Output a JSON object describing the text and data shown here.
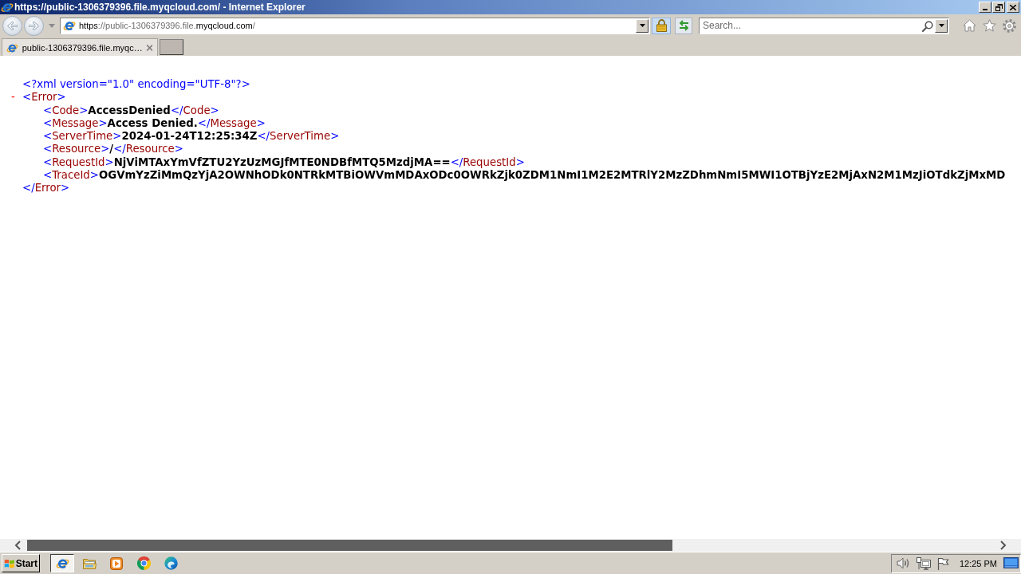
{
  "window": {
    "title": "https://public-1306379396.file.myqcloud.com/ - Internet Explorer"
  },
  "address_bar": {
    "url": [
      {
        "text": "https",
        "emphasis": true
      },
      {
        "text": "://public-1306379396.file.",
        "emphasis": false
      },
      {
        "text": "myqcloud.com",
        "emphasis": true
      },
      {
        "text": "/",
        "emphasis": false
      }
    ]
  },
  "search": {
    "placeholder": "Search..."
  },
  "tabs": [
    {
      "label": "public-1306379396.file.myqc…",
      "selected": true
    }
  ],
  "document": {
    "declaration": "<?xml version=\"1.0\" encoding=\"UTF-8\"?>",
    "root": {
      "toggle": "-",
      "open": [
        {
          "kind": "mark",
          "text": "<"
        },
        {
          "kind": "tag",
          "text": "Error"
        },
        {
          "kind": "mark",
          "text": ">"
        }
      ],
      "children": [
        {
          "tokens": [
            {
              "kind": "mark",
              "text": "<"
            },
            {
              "kind": "tag",
              "text": "Code"
            },
            {
              "kind": "mark",
              "text": ">"
            },
            {
              "kind": "value",
              "text": "AccessDenied"
            },
            {
              "kind": "mark",
              "text": "</"
            },
            {
              "kind": "tag",
              "text": "Code"
            },
            {
              "kind": "mark",
              "text": ">"
            }
          ]
        },
        {
          "tokens": [
            {
              "kind": "mark",
              "text": "<"
            },
            {
              "kind": "tag",
              "text": "Message"
            },
            {
              "kind": "mark",
              "text": ">"
            },
            {
              "kind": "value",
              "text": "Access Denied."
            },
            {
              "kind": "mark",
              "text": "</"
            },
            {
              "kind": "tag",
              "text": "Message"
            },
            {
              "kind": "mark",
              "text": ">"
            }
          ]
        },
        {
          "tokens": [
            {
              "kind": "mark",
              "text": "<"
            },
            {
              "kind": "tag",
              "text": "ServerTime"
            },
            {
              "kind": "mark",
              "text": ">"
            },
            {
              "kind": "value",
              "text": "2024-01-24T12:25:34Z"
            },
            {
              "kind": "mark",
              "text": "</"
            },
            {
              "kind": "tag",
              "text": "ServerTime"
            },
            {
              "kind": "mark",
              "text": ">"
            }
          ]
        },
        {
          "tokens": [
            {
              "kind": "mark",
              "text": "<"
            },
            {
              "kind": "tag",
              "text": "Resource"
            },
            {
              "kind": "mark",
              "text": ">"
            },
            {
              "kind": "value",
              "text": "/"
            },
            {
              "kind": "mark",
              "text": "</"
            },
            {
              "kind": "tag",
              "text": "Resource"
            },
            {
              "kind": "mark",
              "text": ">"
            }
          ]
        },
        {
          "tokens": [
            {
              "kind": "mark",
              "text": "<"
            },
            {
              "kind": "tag",
              "text": "RequestId"
            },
            {
              "kind": "mark",
              "text": ">"
            },
            {
              "kind": "value",
              "text": "NjViMTAxYmVfZTU2YzUzMGJfMTE0NDBfMTQ5MzdjMA=="
            },
            {
              "kind": "mark",
              "text": "</"
            },
            {
              "kind": "tag",
              "text": "RequestId"
            },
            {
              "kind": "mark",
              "text": ">"
            }
          ]
        },
        {
          "tokens": [
            {
              "kind": "mark",
              "text": "<"
            },
            {
              "kind": "tag",
              "text": "TraceId"
            },
            {
              "kind": "mark",
              "text": ">"
            },
            {
              "kind": "value",
              "text": "OGVmYzZiMmQzYjA2OWNhODk0NTRkMTBiOWVmMDAxODc0OWRkZjk0ZDM1NmI1M2E2MTRlY2MzZDhmNmI5MWI1OTBjYzE2MjAxN2M1MzJiOTdkZjMxMD"
            }
          ]
        }
      ],
      "close": [
        {
          "kind": "mark",
          "text": "</"
        },
        {
          "kind": "tag",
          "text": "Error"
        },
        {
          "kind": "mark",
          "text": ">"
        }
      ]
    }
  },
  "taskbar": {
    "start": "Start",
    "apps": [
      {
        "kind": "ie",
        "selected": true
      },
      {
        "kind": "folder",
        "selected": false
      },
      {
        "kind": "media",
        "selected": false
      },
      {
        "kind": "chrome",
        "selected": false
      },
      {
        "kind": "edge",
        "selected": false
      }
    ],
    "clock": "12:25 PM"
  }
}
